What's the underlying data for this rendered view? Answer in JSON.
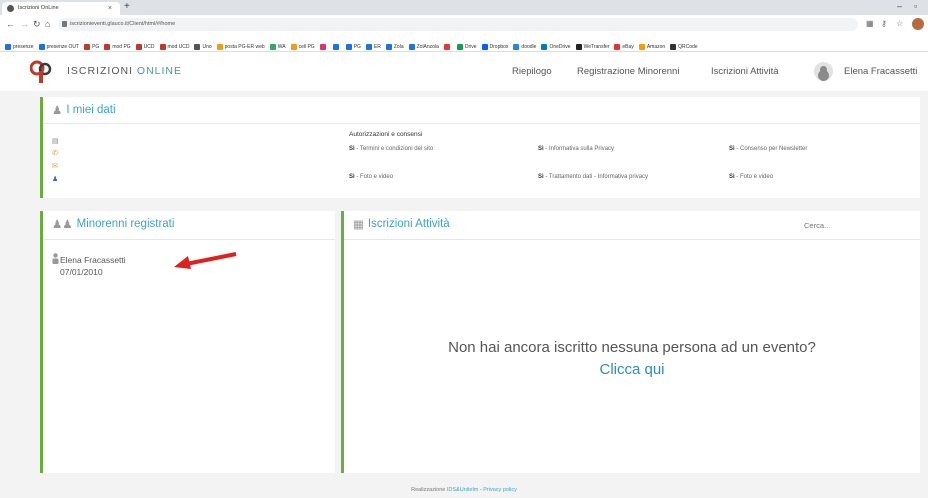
{
  "browser": {
    "tab_title": "Iscrizioni OnLine",
    "tab_close": "×",
    "new_tab": "+",
    "url": "iscrizionieventi.glauco.it/Client/html/#/home",
    "bookmarks": [
      {
        "label": "presenze",
        "color": "#1a73e8"
      },
      {
        "label": "presenze OUT",
        "color": "#1a73e8"
      },
      {
        "label": "PG",
        "color": "#c0392b"
      },
      {
        "label": "mod PG",
        "color": "#c0392b"
      },
      {
        "label": "UCD",
        "color": "#c0392b"
      },
      {
        "label": "mod UCD",
        "color": "#c0392b"
      },
      {
        "label": "Uno",
        "color": "#555555"
      },
      {
        "label": "posta PG-ER web",
        "color": "#f39c12"
      },
      {
        "label": "WA",
        "color": "#27ae60"
      },
      {
        "label": "cell PG",
        "color": "#f39c12"
      },
      {
        "label": "",
        "color": "#e1306c"
      },
      {
        "label": "",
        "color": "#1a73e8"
      },
      {
        "label": "PG",
        "color": "#1a73e8"
      },
      {
        "label": "ER",
        "color": "#1a73e8"
      },
      {
        "label": "Zola",
        "color": "#1a73e8"
      },
      {
        "label": "ZolAnzola",
        "color": "#1a73e8"
      },
      {
        "label": "",
        "color": "#e53935"
      },
      {
        "label": "Drive",
        "color": "#0f9d58"
      },
      {
        "label": "Dropbox",
        "color": "#0061fe"
      },
      {
        "label": "doodle",
        "color": "#1e88e5"
      },
      {
        "label": "OneDrive",
        "color": "#0078d4"
      },
      {
        "label": "WeTransfer",
        "color": "#222222"
      },
      {
        "label": "eBay",
        "color": "#e53238"
      },
      {
        "label": "Amazon",
        "color": "#ff9900"
      },
      {
        "label": "QRCode",
        "color": "#333333"
      }
    ]
  },
  "header": {
    "title_part1": "ISCRIZIONI ",
    "title_part2": "ONLINE",
    "nav": [
      "Riepilogo",
      "Registrazione Minorenni",
      "Iscrizioni Attività"
    ],
    "user_name": "Elena Fracassetti"
  },
  "my_data": {
    "title": "I miei dati",
    "consent_header": "Autorizzazioni e consensi",
    "consents": [
      {
        "value": "Sì",
        "label": " - Termini e condizioni del sito"
      },
      {
        "value": "Sì",
        "label": " - Informativa sulla Privacy"
      },
      {
        "value": "Sì",
        "label": " - Consenso per Newsletter"
      },
      {
        "value": "Sì",
        "label": " - Foto e video"
      },
      {
        "value": "Sì",
        "label": " - Trattamento dati - Informativa privacy"
      },
      {
        "value": "Sì",
        "label": " - Foto e video"
      }
    ]
  },
  "minors": {
    "title": "Minorenni registrati",
    "items": [
      {
        "name": "Elena Fracassetti",
        "birthdate": "07/01/2010"
      }
    ]
  },
  "activities": {
    "title": "Iscrizioni Attività",
    "search_placeholder": "Cerca...",
    "empty_message": "Non hai ancora iscritto nessuna persona ad un evento?",
    "empty_link": "Clicca qui"
  },
  "footer": {
    "prefix": "Realizzazione ",
    "company": "IDS&Unitelm",
    "sep": " - ",
    "privacy": "Privacy policy"
  },
  "colors": {
    "accent_green": "#6aac3d",
    "title_blue": "#3aa4c9",
    "arrow_red": "#e02020"
  }
}
